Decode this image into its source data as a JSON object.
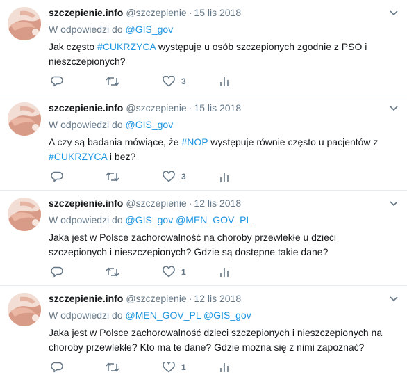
{
  "replying_label": "W odpowiedzi do",
  "icons": [
    "avatar",
    "caret-down-icon",
    "reply-icon",
    "retweet-icon",
    "heart-icon",
    "analytics-icon"
  ],
  "colors": {
    "link": "#1b95e0",
    "muted": "#657786",
    "text": "#14171a",
    "border": "#e6ecf0"
  },
  "tweets": [
    {
      "name": "szczepienie.info",
      "handle": "@szczepienie",
      "sep": "·",
      "date": "15 lis 2018",
      "reply_to": [
        "@GIS_gov"
      ],
      "text_parts": [
        "Jak często ",
        "#CUKRZYCA",
        " występuje u osób szczepionych zgodnie z PSO i nieszczepionych?",
        "",
        ""
      ],
      "likes": "3"
    },
    {
      "name": "szczepienie.info",
      "handle": "@szczepienie",
      "sep": "·",
      "date": "15 lis 2018",
      "reply_to": [
        "@GIS_gov"
      ],
      "text_parts": [
        "A czy są badania mówiące, że ",
        "#NOP",
        " występuje równie często u pacjentów z ",
        "#CUKRZYCA",
        " i bez?"
      ],
      "likes": "3"
    },
    {
      "name": "szczepienie.info",
      "handle": "@szczepienie",
      "sep": "·",
      "date": "12 lis 2018",
      "reply_to": [
        "@GIS_gov",
        "@MEN_GOV_PL"
      ],
      "text_parts": [
        "Jaka jest w Polsce zachorowalność na choroby przewlekłe u dzieci szczepionych i nieszczepionych? Gdzie są dostępne takie dane?",
        "",
        "",
        "",
        ""
      ],
      "likes": "1"
    },
    {
      "name": "szczepienie.info",
      "handle": "@szczepienie",
      "sep": "·",
      "date": "12 lis 2018",
      "reply_to": [
        "@MEN_GOV_PL",
        "@GIS_gov"
      ],
      "text_parts": [
        "Jaka jest w Polsce zachorowalność dzieci szczepionych i nieszczepionych na choroby przewlekłe? Kto ma te dane? Gdzie można się z nimi zapoznać?",
        "",
        "",
        "",
        ""
      ],
      "likes": "1"
    }
  ]
}
